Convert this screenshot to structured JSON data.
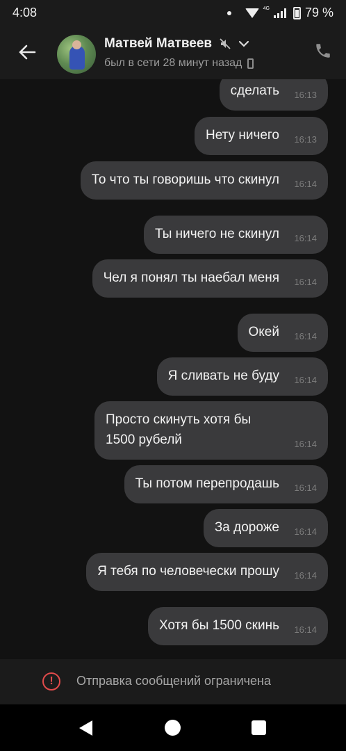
{
  "status_bar": {
    "time": "4:08",
    "network": "4G",
    "battery": "79 %"
  },
  "header": {
    "contact_name": "Матвей Матвеев",
    "last_seen": "был в сети 28 минут назад"
  },
  "messages": [
    {
      "text": "сделать",
      "time": "16:13"
    },
    {
      "text": "Нету ничего",
      "time": "16:13"
    },
    {
      "text": "То что ты говоришь что скинул",
      "time": "16:14"
    },
    {
      "text": "Ты ничего не скинул",
      "time": "16:14"
    },
    {
      "text": "Чел я понял ты наебал меня",
      "time": "16:14"
    },
    {
      "text": "Окей",
      "time": "16:14"
    },
    {
      "text": "Я сливать не буду",
      "time": "16:14"
    },
    {
      "text": "Просто скинуть хотя бы 1500 рубелй",
      "time": "16:14"
    },
    {
      "text": "Ты потом перепродашь",
      "time": "16:14"
    },
    {
      "text": "За дороже",
      "time": "16:14"
    },
    {
      "text": "Я тебя по человечески прошу",
      "time": "16:14"
    },
    {
      "text": "Хотя бы 1500 скинь",
      "time": "16:14"
    }
  ],
  "restriction": {
    "text": "Отправка сообщений ограничена",
    "icon": "alert-circle-icon"
  },
  "colors": {
    "bubble": "#3a3a3c",
    "chat_bg": "#121212",
    "header_bg": "#1b1b1b",
    "alert": "#e24b4b"
  }
}
